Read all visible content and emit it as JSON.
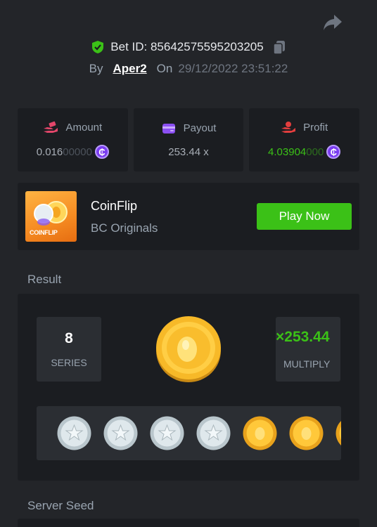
{
  "header": {
    "bet_label": "Bet ID: 85642575595203205",
    "by_label": "By",
    "username": "Aper2",
    "on_label": "On",
    "datetime": "29/12/2022 23:51:22"
  },
  "stats": [
    {
      "label": "Amount",
      "value_bright": "0.016",
      "value_dim": "00000",
      "icon": "amount-hand-icon",
      "currency": "bc-coin-icon"
    },
    {
      "label": "Payout",
      "value_bright": "253.44 x",
      "value_dim": "",
      "icon": "wallet-icon"
    },
    {
      "label": "Profit",
      "value_bright": "4.03904",
      "value_dim": "000",
      "icon": "profit-hand-icon",
      "currency": "bc-coin-icon"
    }
  ],
  "currency_symbol": "₵",
  "game": {
    "name": "CoinFlip",
    "provider": "BC Originals",
    "thumb_label": "COINFLIP",
    "play_label": "Play Now"
  },
  "result": {
    "title": "Result",
    "series_value": "8",
    "series_label": "SERIES",
    "multiply_value": "×253.44",
    "multiply_label": "MULTIPLY",
    "coins": [
      "silver",
      "silver",
      "silver",
      "silver",
      "gold",
      "gold",
      "gold"
    ]
  },
  "server_seed": {
    "title": "Server Seed"
  },
  "colors": {
    "background": "#232529",
    "card": "#1b1d21",
    "accent_green": "#3bc117",
    "coin_purple": "#7b3df0"
  }
}
